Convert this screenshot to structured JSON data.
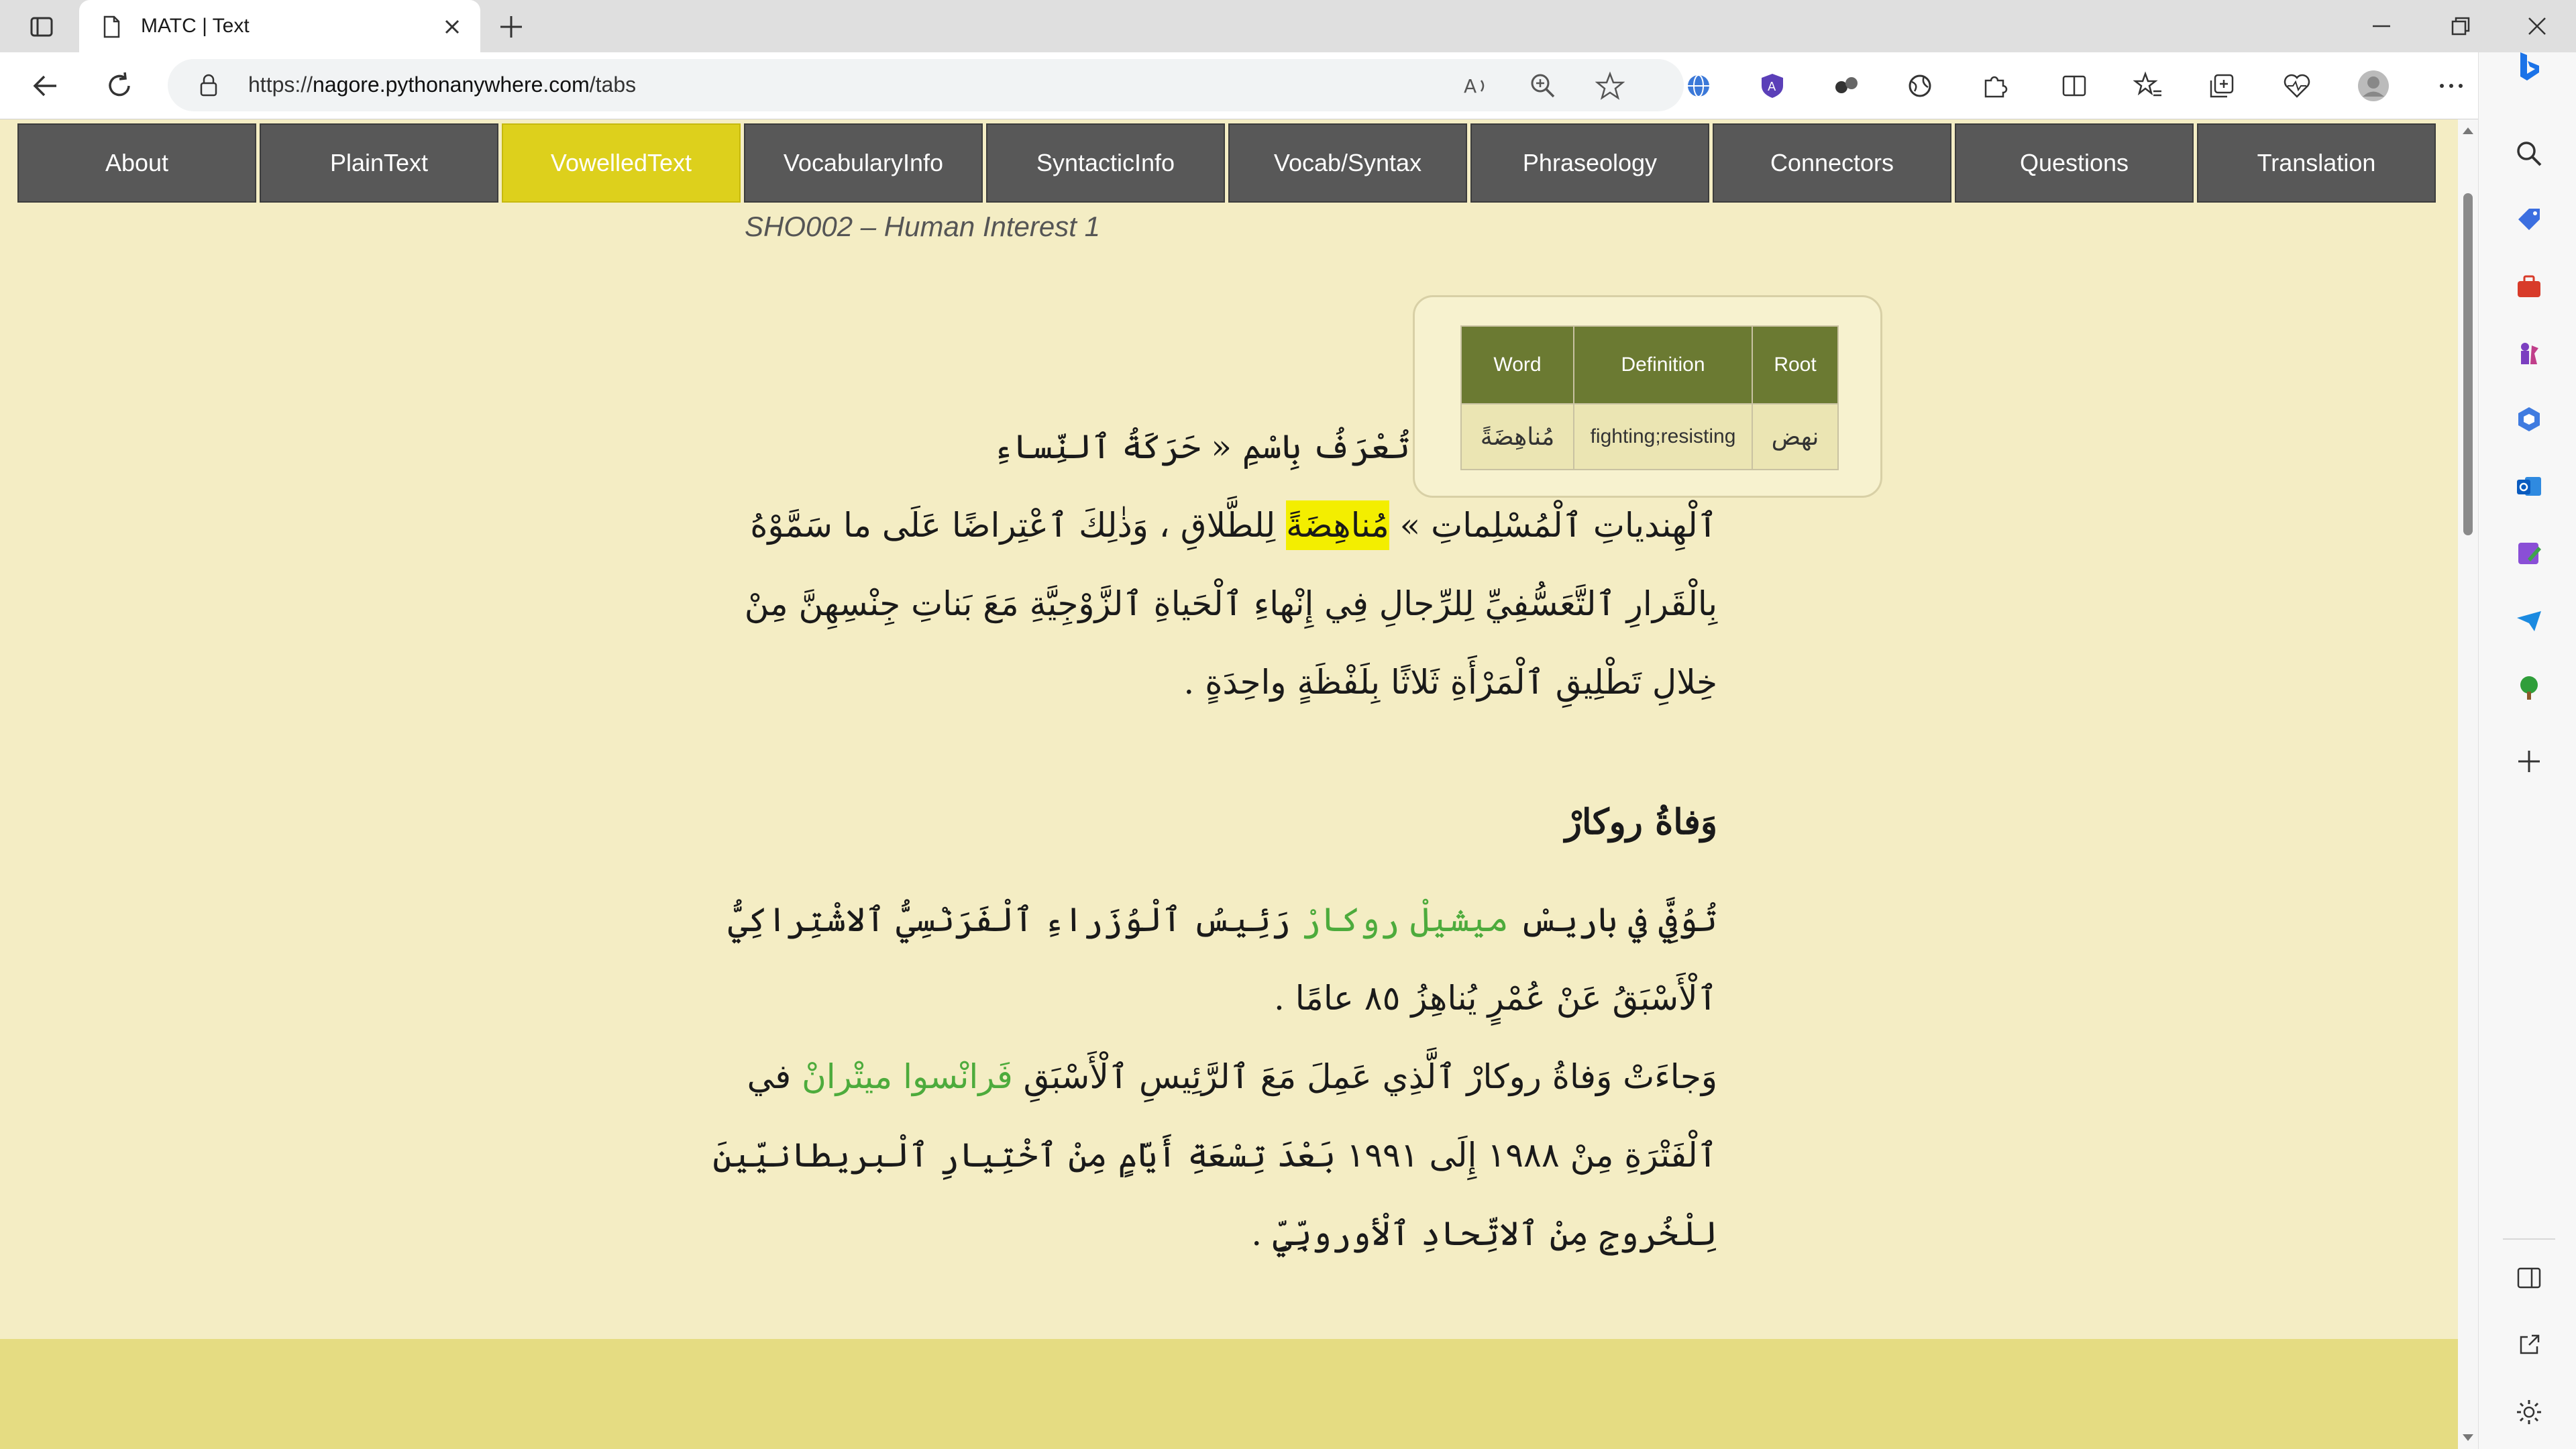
{
  "browser": {
    "tab_title": "MATC | Text",
    "url_prefix": "https://",
    "url_domain": "nagore.pythonanywhere.com",
    "url_path": "/tabs"
  },
  "nav": {
    "items": [
      {
        "label": "About"
      },
      {
        "label": "PlainText"
      },
      {
        "label": "VowelledText",
        "active": true
      },
      {
        "label": "VocabularyInfo"
      },
      {
        "label": "SyntacticInfo"
      },
      {
        "label": "Vocab/Syntax"
      },
      {
        "label": "Phraseology"
      },
      {
        "label": "Connectors"
      },
      {
        "label": "Questions"
      },
      {
        "label": "Translation"
      }
    ],
    "active_color": "#ddd01c",
    "inactive_color": "#585858"
  },
  "document": {
    "title": "SHO002 – Human Interest 1",
    "para1": {
      "line1": "الْهِنْدِ حَرَكَةً جَدِيدَةً تُعْرَفُ بِاسْمِ « حَرَكَةُ ٱلنِّساءِ",
      "line2_start": "ٱلْهِندياتِ ٱلْمُسْلِماتِ » ",
      "line2_highlight": "مُناهِضَةً",
      "line2_end": " لِلطَّلاقِ ، وَذٰلِكَ ٱعْتِراضًا عَلَى ما سَمَّوْهُ",
      "line3": "بِالْقَرارِ ٱلتَّعَسُّفِيِّ لِلرِّجالِ فِي إِنْهاءِ ٱلْحَياةِ ٱلزَّوْجِيَّةِ مَعَ بَناتِ جِنْسِهِنَّ مِنْ",
      "line4": "خِلالِ تَطْلِيقِ ٱلْمَرْأَةِ ثَلاثًا بِلَفْظَةٍ واحِدَةٍ ."
    },
    "heading2": "وَفاةُ روكارْ",
    "para2": {
      "line1_start": "تُوُفِّيَ في باريسْ ",
      "line1_name": "ميشيلْ روكارْ",
      "line1_end": " رَئِيسُ ٱلْوُزَراءِ ٱلْفَرَنْسِيُّ ٱلاشْتِراكِيُّ",
      "line2": "ٱلْأَسْبَقُ عَنْ عُمْرٍ يُناهِزُ ٨٥ عامًا .",
      "line3_start": "وَجاءَتْ وَفاةُ روكارْ ٱلَّذِي عَمِلَ مَعَ ٱلرَّئِيسِ ٱلْأَسْبَقِ ",
      "line3_name": "فَرانْسوا ميتْرانْ",
      "line3_end": " في",
      "line4": "ٱلْفَتْرَةِ مِنْ ١٩٨٨ إِلَى ١٩٩١ بَعْدَ تِسْعَةِ أَيّامٍ مِنْ ٱخْتِيارِ ٱلْبريطانيّينَ",
      "line5": "لِلْخُروجِ مِنْ ٱلاتِّحادِ ٱلْأوروبِّيِّ ."
    },
    "highlight_color": "#f3ee00",
    "name_color": "#4dab3c",
    "background_color": "#f4edc4"
  },
  "popup": {
    "headers": [
      "Word",
      "Definition",
      "Root"
    ],
    "row": [
      "مُناهِضَةً",
      "fighting;resisting",
      "نهض"
    ],
    "header_color": "#6b7a32"
  },
  "icons": {
    "tab_actions": "tab-actions-icon",
    "favicon": "page-icon",
    "close": "close-icon",
    "new_tab": "plus-icon",
    "back": "back-arrow-icon",
    "reload": "reload-icon",
    "lock": "lock-icon",
    "read_aloud": "read-aloud-icon",
    "zoom": "zoom-icon",
    "favorite": "star-icon"
  }
}
